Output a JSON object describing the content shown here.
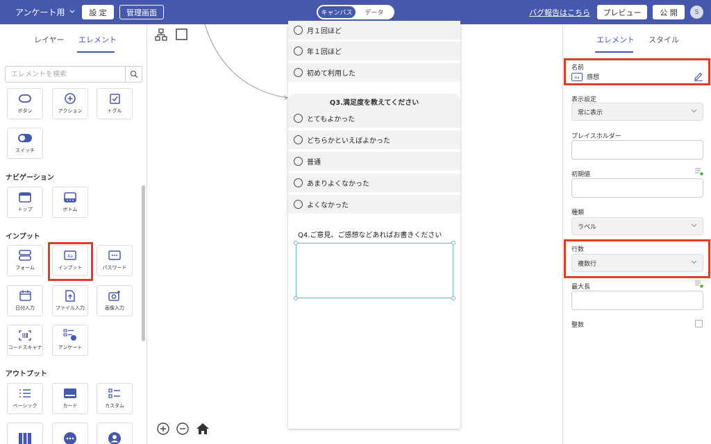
{
  "topbar": {
    "app_title": "アンケート用",
    "settings_label": "設 定",
    "admin_label": "管理画面",
    "mode_options": [
      "キャンバス",
      "データ"
    ],
    "bug_report": "バグ報告はこちら",
    "preview_label": "プレビュー",
    "publish_label": "公 開",
    "avatar_initial": "S"
  },
  "left_panel": {
    "tabs": [
      "レイヤー",
      "エレメント"
    ],
    "active_tab": "エレメント",
    "search_placeholder": "エレメントを検索",
    "sections": {
      "navigation": "ナビゲーション",
      "input": "インプット",
      "output": "アウトプット"
    },
    "tiles": {
      "button": "ボタン",
      "action": "アクション",
      "toggle": "トグル",
      "switch": "スイッチ",
      "top": "トップ",
      "bottom": "ボトム",
      "form": "フォーム",
      "input": "インプット",
      "password": "パスワード",
      "date_input": "日付入力",
      "file_input": "ファイル入力",
      "image_input": "画像入力",
      "code_scanner": "コードスキャナ",
      "survey": "アンケート",
      "basic": "ベーシック",
      "card": "カード",
      "custom": "カスタム"
    }
  },
  "canvas": {
    "q2_options": [
      "月１回ほど",
      "年１回ほど",
      "初めて利用した"
    ],
    "q3_title": "Q3.満足度を教えてください",
    "q3_options": [
      "とてもよかった",
      "どちらかといえばよかった",
      "普通",
      "あまりよくなかった",
      "よくなかった"
    ],
    "q4_title": "Q4.ご意見、ご感想などあればお書きください"
  },
  "right_panel": {
    "tabs": [
      "エレメント",
      "スタイル"
    ],
    "active_tab": "エレメント",
    "name_label": "名前",
    "name_value": "感想",
    "display_label": "表示設定",
    "display_value": "常に表示",
    "placeholder_label": "プレイスホルダー",
    "initial_label": "初期値",
    "type_label": "種類",
    "type_value": "ラベル",
    "rows_label": "行数",
    "rows_value": "複数行",
    "maxlen_label": "最大長",
    "integer_label": "整数"
  },
  "colors": {
    "primary": "#4658ac",
    "highlight": "#e03c2a",
    "selection": "#6fb3c9"
  }
}
